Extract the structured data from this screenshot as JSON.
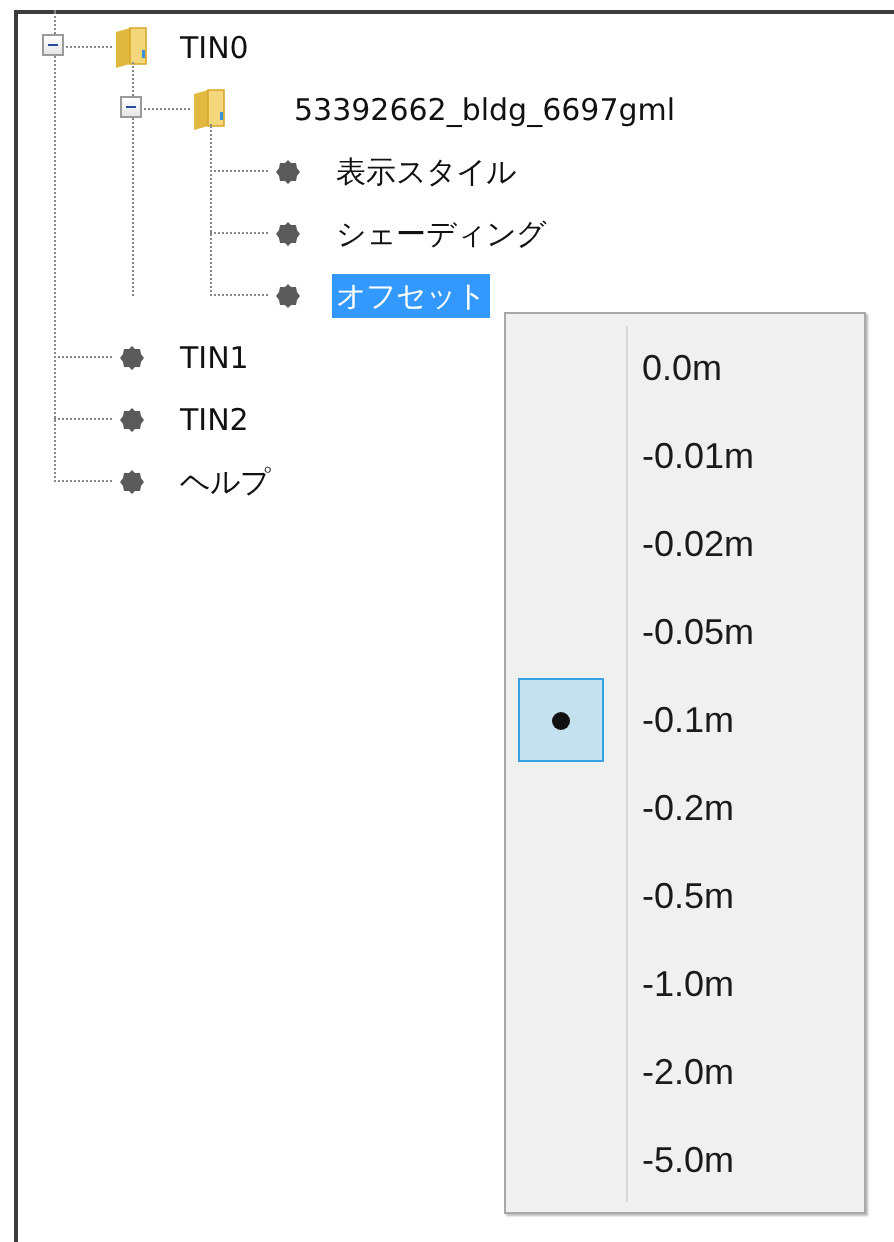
{
  "tree": [
    {
      "label": "TIN0",
      "kind": "folder",
      "expanded": true,
      "selected": false,
      "children": [
        {
          "label": "53392662_bldg_6697gml",
          "kind": "folder",
          "expanded": true,
          "selected": false,
          "children": [
            {
              "label": "表示スタイル",
              "kind": "leaf",
              "selected": false
            },
            {
              "label": "シェーディング",
              "kind": "leaf",
              "selected": false
            },
            {
              "label": "オフセット",
              "kind": "leaf",
              "selected": true
            }
          ]
        }
      ]
    },
    {
      "label": "TIN1",
      "kind": "leaf",
      "selected": false
    },
    {
      "label": "TIN2",
      "kind": "leaf",
      "selected": false
    },
    {
      "label": "ヘルプ",
      "kind": "leaf",
      "selected": false
    }
  ],
  "context_menu": {
    "items": [
      {
        "label": "0.0m",
        "selected": false
      },
      {
        "label": "-0.01m",
        "selected": false
      },
      {
        "label": "-0.02m",
        "selected": false
      },
      {
        "label": "-0.05m",
        "selected": false
      },
      {
        "label": "-0.1m",
        "selected": true
      },
      {
        "label": "-0.2m",
        "selected": false
      },
      {
        "label": "-0.5m",
        "selected": false
      },
      {
        "label": "-1.0m",
        "selected": false
      },
      {
        "label": "-2.0m",
        "selected": false
      },
      {
        "label": "-5.0m",
        "selected": false
      }
    ]
  }
}
